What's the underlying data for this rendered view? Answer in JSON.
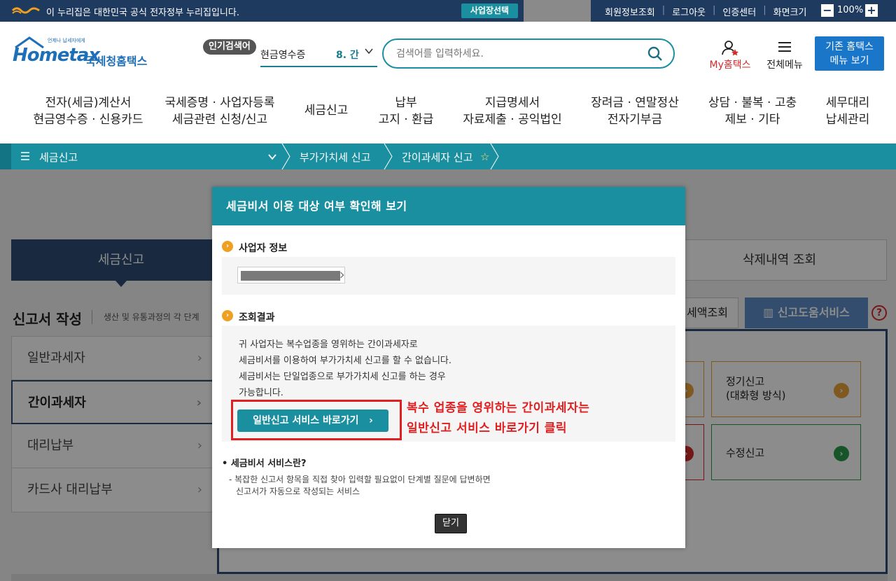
{
  "gov_banner": {
    "text": "이 누리집은 대한민국 공식 전자정부 누리집입니다.",
    "biz_select_label": "사업장선택",
    "links": [
      "회원정보조회",
      "로그아웃",
      "인증센터",
      "화면크기"
    ],
    "zoom_level": "100%",
    "zoom_minus": "−",
    "zoom_plus": "+"
  },
  "header": {
    "logo_small": "언제나 납세자에게",
    "logo_text": "Hometax",
    "logo_kr": "국세청홈택스",
    "popular_badge": "인기검색어",
    "popular_term": "현금영수증",
    "popular_rank": "8. 간",
    "search_placeholder": "검색어를 입력하세요.",
    "my_hometax": "My홈택스",
    "all_menu": "전체메뉴",
    "old_menu_line1": "기존 홈택스",
    "old_menu_line2": "메뉴 보기"
  },
  "gnb": [
    {
      "line1": "전자(세금)계산서",
      "line2": "현금영수증 · 신용카드"
    },
    {
      "line1": "국세증명 · 사업자등록",
      "line2": "세금관련 신청/신고"
    },
    {
      "line1": "세금신고",
      "line2": ""
    },
    {
      "line1": "납부",
      "line2": "고지 · 환급"
    },
    {
      "line1": "지급명세서",
      "line2": "자료제출 · 공익법인"
    },
    {
      "line1": "장려금 · 연말정산",
      "line2": "전자기부금"
    },
    {
      "line1": "상담 · 불복 · 고충",
      "line2": "제보 · 기타"
    },
    {
      "line1": "세무대리",
      "line2": "납세관리"
    }
  ],
  "breadcrumb": {
    "level1": "세금신고",
    "level2": "부가가치세 신고",
    "level3": "간이과세자 신고"
  },
  "background_page": {
    "tab_active": "세금신고",
    "tab_right": "삭제내역 조회",
    "section_title": "신고서 작성",
    "section_sub": "생산 및 유통과정의 각 단계",
    "btn_amount": "세액조회",
    "btn_help": "신고도움서비스",
    "help_q": "?",
    "side_menu": [
      "일반과세자",
      "간이과세자",
      "대리납부",
      "카드사 대리납부"
    ],
    "card_regular_line1": "정기신고",
    "card_regular_line2": "(대화형 방식)",
    "card_amend": "수정신고"
  },
  "modal": {
    "title": "세금비서 이용 대상 여부 확인해 보기",
    "section_business": "사업자 정보",
    "section_result": "조회결과",
    "result_lines": [
      "귀 사업자는 복수업종을 영위하는 간이과세자로",
      "세금비서를 이용하여 부가가치세 신고를 할 수 없습니다.",
      "세금비서는 단일업종으로 부가가치세 신고를 하는 경우",
      "가능합니다."
    ],
    "go_general_button": "일반신고 서비스 바로가기",
    "annotation_line1": "복수 업종을 영위하는 간이과세자는",
    "annotation_line2": "일반신고 서비스 바로가기 클릭",
    "about_title": "• 세금비서 서비스란?",
    "about_line1": "- 복잡한 신고서 항목을 직접 찾아 입력할 필요없이 단계별 질문에 답변하면",
    "about_line2": "신고서가 자동으로 작성되는 서비스",
    "close_button": "닫기"
  },
  "colors": {
    "gov_bar": "#1f3a5f",
    "accent_teal": "#1a8fa0",
    "brand_blue": "#1d6fb8",
    "annotation_red": "#e02020"
  }
}
